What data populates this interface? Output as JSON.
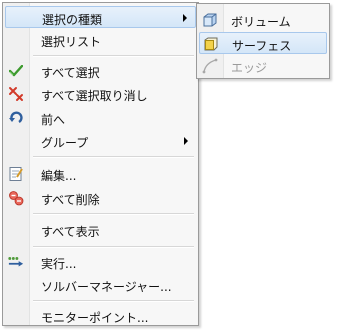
{
  "menu": {
    "items": [
      {
        "label": "選択の種類",
        "has_submenu": true,
        "icon": null
      },
      {
        "label": "選択リスト",
        "has_submenu": false,
        "icon": null
      },
      {
        "label": "すべて選択",
        "has_submenu": false,
        "icon": "select-all-check-icon"
      },
      {
        "label": "すべて選択取り消し",
        "has_submenu": false,
        "icon": "deselect-all-x-icon"
      },
      {
        "label": "前へ",
        "has_submenu": false,
        "icon": "previous-arrow-icon"
      },
      {
        "label": "グループ",
        "has_submenu": true,
        "icon": null
      },
      {
        "label": "編集...",
        "has_submenu": false,
        "icon": "edit-note-icon"
      },
      {
        "label": "すべて削除",
        "has_submenu": false,
        "icon": "delete-all-icon"
      },
      {
        "label": "すべて表示",
        "has_submenu": false,
        "icon": null
      },
      {
        "label": "実行...",
        "has_submenu": false,
        "icon": "run-arrow-icon"
      },
      {
        "label": "ソルバーマネージャー...",
        "has_submenu": false,
        "icon": null
      },
      {
        "label": "モニターポイント...",
        "has_submenu": false,
        "icon": null
      }
    ]
  },
  "submenu": {
    "items": [
      {
        "label": "ボリューム",
        "icon": "volume-cube-icon",
        "enabled": true,
        "highlighted": false
      },
      {
        "label": "サーフェス",
        "icon": "surface-face-icon",
        "enabled": true,
        "highlighted": true
      },
      {
        "label": "エッジ",
        "icon": "edge-curve-icon",
        "enabled": false,
        "highlighted": false
      }
    ]
  },
  "colors": {
    "highlight_border": "#a8c8ec",
    "highlight_fill": "#dbeaf9",
    "check_green": "#3c9a2e",
    "delete_red": "#d23a2a",
    "disabled_text": "#9b9b9b"
  }
}
